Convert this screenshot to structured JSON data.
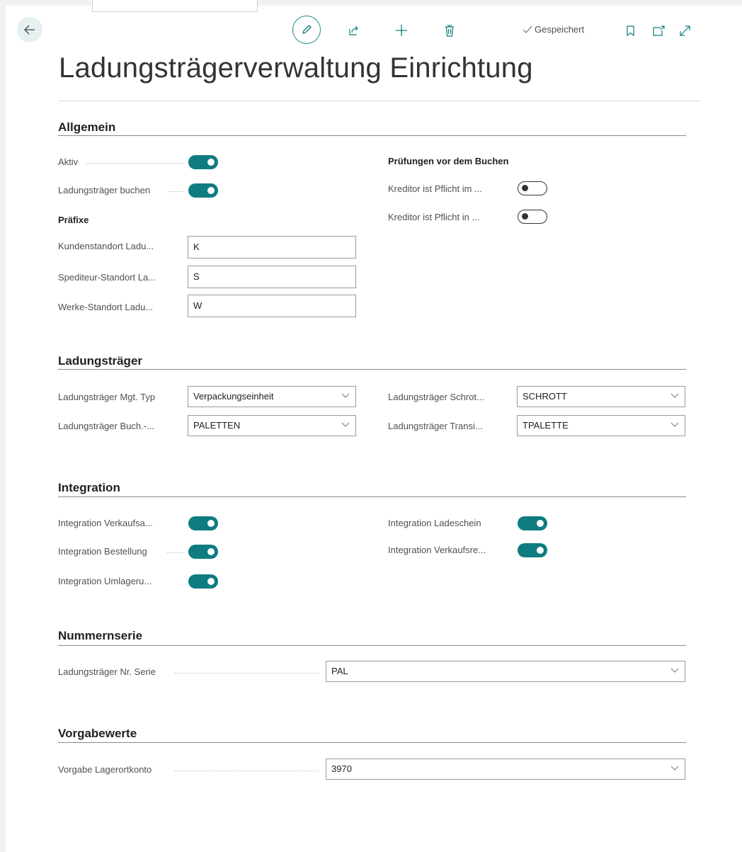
{
  "header": {
    "title": "Ladungsträgerverwaltung Einrichtung",
    "status": "Gespeichert"
  },
  "toolbar": {
    "icons": [
      "back-arrow-icon",
      "edit-pencil-icon",
      "share-icon",
      "plus-icon",
      "delete-icon",
      "check-icon",
      "bookmark-icon",
      "open-new-window-icon",
      "expand-icon"
    ]
  },
  "colors": {
    "accent": "#0e7c80",
    "toggle_off": "#333333"
  },
  "sections": {
    "general": {
      "title": "Allgemein",
      "active": {
        "label": "Aktiv",
        "value": true
      },
      "post_carriers": {
        "label": "Ladungsträger buchen",
        "value": true
      },
      "prefixes_heading": "Präfixe",
      "customer_location": {
        "label": "Kundenstandort Ladu...",
        "value": "K"
      },
      "carrier_location": {
        "label": "Spediteur-Standort La...",
        "value": "S"
      },
      "plant_location": {
        "label": "Werke-Standort Ladu...",
        "value": "W"
      },
      "checks_heading": "Prüfungen vor dem Buchen",
      "vendor_required_1": {
        "label": "Kreditor ist Pflicht im ...",
        "value": false
      },
      "vendor_required_2": {
        "label": "Kreditor ist Pflicht in ...",
        "value": false
      }
    },
    "carriers": {
      "title": "Ladungsträger",
      "mgt_type": {
        "label": "Ladungsträger Mgt. Typ",
        "value": "Verpackungseinheit"
      },
      "posting_group": {
        "label": "Ladungsträger Buch.-...",
        "value": "PALETTEN"
      },
      "scrap": {
        "label": "Ladungsträger Schrot...",
        "value": "SCHROTT"
      },
      "transit": {
        "label": "Ladungsträger  Transi...",
        "value": "TPALETTE"
      }
    },
    "integration": {
      "title": "Integration",
      "sales_order": {
        "label": "Integration Verkaufsa...",
        "value": true
      },
      "purchase_order": {
        "label": "Integration Bestellung",
        "value": true
      },
      "transfer": {
        "label": "Integration Umlageru...",
        "value": true
      },
      "loading_slip": {
        "label": "Integration Ladeschein",
        "value": true
      },
      "sales_invoice": {
        "label": "Integration Verkaufsre...",
        "value": true
      }
    },
    "numbering": {
      "title": "Nummernserie",
      "series": {
        "label": "Ladungsträger Nr. Serie",
        "value": "PAL"
      }
    },
    "defaults": {
      "title": "Vorgabewerte",
      "location_account": {
        "label": "Vorgabe Lagerortkonto",
        "value": "3970"
      }
    }
  }
}
